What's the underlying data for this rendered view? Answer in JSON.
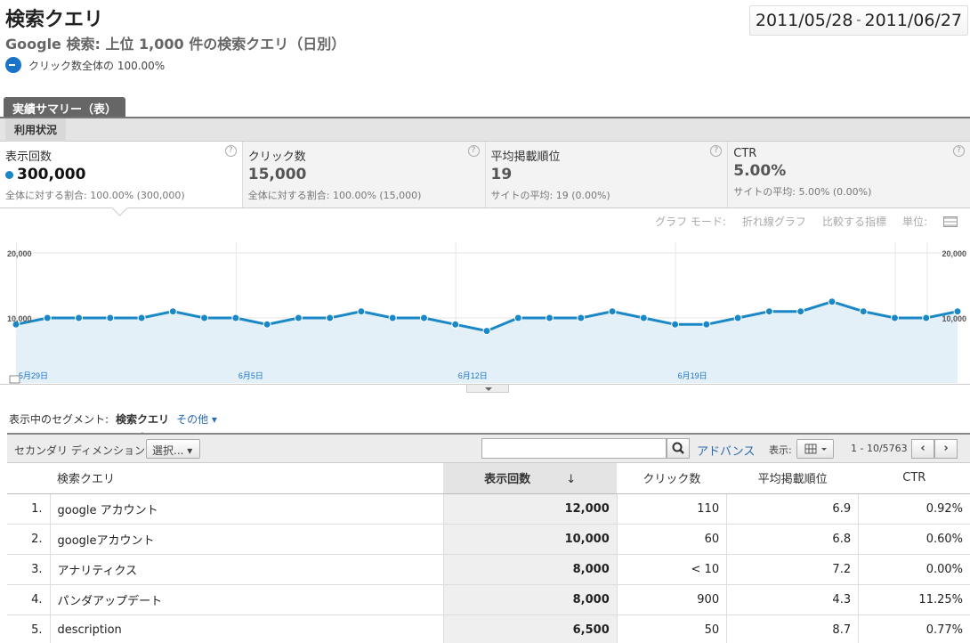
{
  "header": {
    "title": "検索クエリ",
    "subtitle": "Google 検索: 上位 1,000 件の検索クエリ（日別）",
    "segment_text": "クリック数全体の 100.00%",
    "date_start": "2011/05/28",
    "date_sep": "-",
    "date_end": "2011/06/27"
  },
  "tabs": {
    "main": "実績サマリー（表）",
    "sub": "利用状況"
  },
  "metrics": [
    {
      "label": "表示回数",
      "value": "300,000",
      "sub": "全体に対する割合: 100.00% (300,000)"
    },
    {
      "label": "クリック数",
      "value": "15,000",
      "sub": "全体に対する割合: 100.00% (15,000)"
    },
    {
      "label": "平均掲載順位",
      "value": "19",
      "sub": "サイトの平均: 19 (0.00%)"
    },
    {
      "label": "CTR",
      "value": "5.00%",
      "sub": "サイトの平均: 5.00% (0.00%)"
    }
  ],
  "graph_options": {
    "mode_label": "グラフ モード:",
    "mode_value": "折れ線グラフ",
    "compare": "比較する指標",
    "unit": "単位:"
  },
  "chart_data": {
    "type": "area",
    "series": [
      {
        "values": [
          9000,
          10000,
          10000,
          10000,
          10000,
          11000,
          10000,
          10000,
          9000,
          10000,
          10000,
          11000,
          10000,
          10000,
          9000,
          8000,
          10000,
          10000,
          10000,
          11000,
          10000,
          9000,
          9000,
          10000,
          11000,
          11000,
          12500,
          11000,
          10000,
          10000,
          11000
        ]
      }
    ],
    "ylim": [
      0,
      20000
    ],
    "y_ticks": [
      "20,000",
      "10,000"
    ],
    "x_ticks": [
      "5月29日",
      "6月5日",
      "6月12日",
      "6月19日"
    ],
    "color": "#1a87c6",
    "fill": "#e3f0f8"
  },
  "segments": {
    "label": "表示中のセグメント:",
    "active": "検索クエリ",
    "other": "その他"
  },
  "toolbar": {
    "secondary_label": "セカンダリ ディメンション:",
    "select_label": "選択...",
    "search_placeholder": "",
    "advanced": "アドバンス",
    "display_label": "表示:",
    "pager": "1 - 10/5763"
  },
  "table": {
    "headers": [
      "検索クエリ",
      "表示回数",
      "クリック数",
      "平均掲載順位",
      "CTR"
    ],
    "rows": [
      {
        "idx": "1.",
        "q": "google アカウント",
        "imp": "12,000",
        "clk": "110",
        "pos": "6.9",
        "ctr": "0.92%"
      },
      {
        "idx": "2.",
        "q": "googleアカウント",
        "imp": "10,000",
        "clk": "60",
        "pos": "6.8",
        "ctr": "0.60%"
      },
      {
        "idx": "3.",
        "q": "アナリティクス",
        "imp": "8,000",
        "clk": "< 10",
        "pos": "7.2",
        "ctr": "0.00%"
      },
      {
        "idx": "4.",
        "q": "パンダアップデート",
        "imp": "8,000",
        "clk": "900",
        "pos": "4.3",
        "ctr": "11.25%"
      },
      {
        "idx": "5.",
        "q": "description",
        "imp": "6,500",
        "clk": "50",
        "pos": "8.7",
        "ctr": "0.77%"
      }
    ]
  }
}
